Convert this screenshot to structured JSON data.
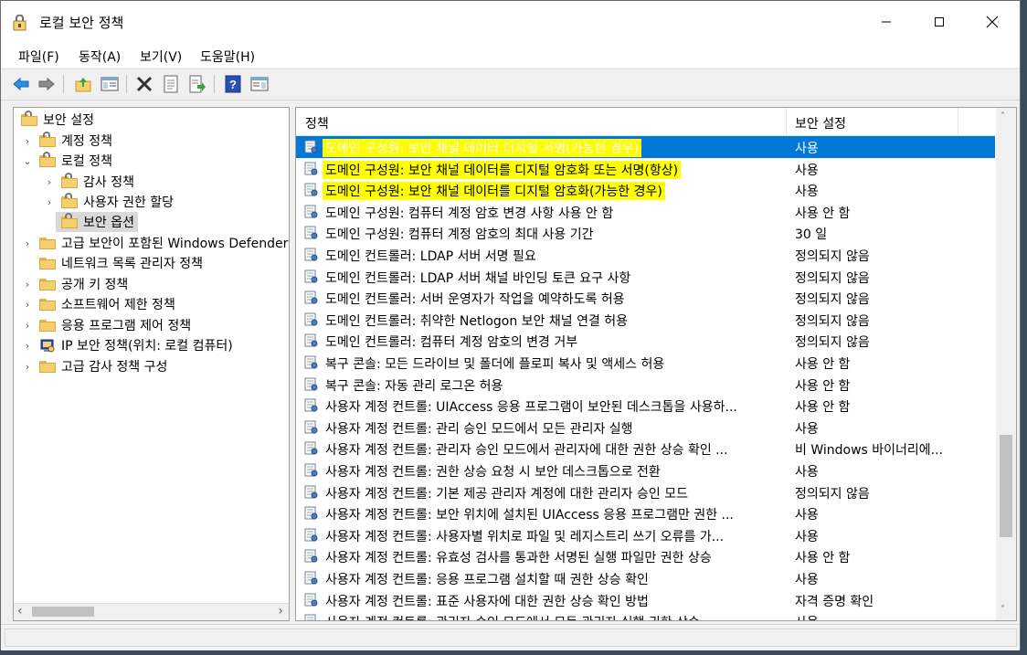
{
  "window": {
    "title": "로컬 보안 정책",
    "caption": {
      "minimize": "─",
      "maximize": "☐",
      "close": "✕"
    }
  },
  "menu": [
    "파일(F)",
    "동작(A)",
    "보기(V)",
    "도움말(H)"
  ],
  "toolbar": {
    "icons": [
      "back-icon",
      "forward-icon",
      "up-folder-icon",
      "show-hide-tree-icon",
      "delete-icon",
      "properties-icon",
      "export-list-icon",
      "help-icon",
      "show-console-icon"
    ]
  },
  "tree": {
    "root": "보안 설정",
    "items": [
      {
        "label": "계정 정책",
        "expander": "›"
      },
      {
        "label": "로컬 정책",
        "expander": "⌄"
      },
      {
        "label": "감사 정책",
        "expander": "›"
      },
      {
        "label": "사용자 권한 할당",
        "expander": "›"
      },
      {
        "label": "보안 옵션",
        "expander": ""
      },
      {
        "label": "고급 보안이 포함된 Windows Defender",
        "expander": "›"
      },
      {
        "label": "네트워크 목록 관리자 정책",
        "expander": ""
      },
      {
        "label": "공개 키 정책",
        "expander": "›"
      },
      {
        "label": "소프트웨어 제한 정책",
        "expander": "›"
      },
      {
        "label": "응용 프로그램 제어 정책",
        "expander": "›"
      },
      {
        "label": "IP 보안 정책(위치: 로컬 컴퓨터)",
        "expander": "›"
      },
      {
        "label": "고급 감사 정책 구성",
        "expander": "›"
      }
    ],
    "scroll": {
      "left": "‹",
      "right": "›"
    }
  },
  "list": {
    "columns": {
      "policy": "정책",
      "setting": "보안 설정",
      "sort_indicator": "˄"
    },
    "rows": [
      {
        "policy": "도메인 구성원: 보안 채널 데이터 디지털 서명(가능한 경우)",
        "setting": "사용"
      },
      {
        "policy": "도메인 구성원: 보안 채널 데이터를 디지털 암호화 또는 서명(항상)",
        "setting": "사용"
      },
      {
        "policy": "도메인 구성원: 보안 채널 데이터를 디지털 암호화(가능한 경우)",
        "setting": "사용"
      },
      {
        "policy": "도메인 구성원: 컴퓨터 계정 암호 변경 사항 사용 안 함",
        "setting": "사용 안 함"
      },
      {
        "policy": "도메인 구성원: 컴퓨터 계정 암호의 최대 사용 기간",
        "setting": "30 일"
      },
      {
        "policy": "도메인 컨트롤러: LDAP 서버 서명 필요",
        "setting": "정의되지 않음"
      },
      {
        "policy": "도메인 컨트롤러: LDAP 서버 채널 바인딩 토큰 요구 사항",
        "setting": "정의되지 않음"
      },
      {
        "policy": "도메인 컨트롤러: 서버 운영자가 작업을 예약하도록 허용",
        "setting": "정의되지 않음"
      },
      {
        "policy": "도메인 컨트롤러: 취약한 Netlogon 보안 채널 연결 허용",
        "setting": "정의되지 않음"
      },
      {
        "policy": "도메인 컨트롤러: 컴퓨터 계정 암호의 변경 거부",
        "setting": "정의되지 않음"
      },
      {
        "policy": "복구 콘솔: 모든 드라이브 및 폴더에 플로피 복사 및 액세스 허용",
        "setting": "사용 안 함"
      },
      {
        "policy": "복구 콘솔: 자동 관리 로그온 허용",
        "setting": "사용 안 함"
      },
      {
        "policy": "사용자 계정 컨트롤: UIAccess 응용 프로그램이 보안된 데스크톱을 사용하...",
        "setting": "사용 안 함"
      },
      {
        "policy": "사용자 계정 컨트롤: 관리 승인 모드에서 모든 관리자 실행",
        "setting": "사용"
      },
      {
        "policy": "사용자 계정 컨트롤: 관리자 승인 모드에서 관리자에 대한 권한 상승 확인 ...",
        "setting": "비 Windows 바이너리에..."
      },
      {
        "policy": "사용자 계정 컨트롤: 권한 상승 요청 시 보안 데스크톱으로 전환",
        "setting": "사용"
      },
      {
        "policy": "사용자 계정 컨트롤: 기본 제공 관리자 계정에 대한 관리자 승인 모드",
        "setting": "정의되지 않음"
      },
      {
        "policy": "사용자 계정 컨트롤: 보안 위치에 설치된 UIAccess 응용 프로그램만 권한 ...",
        "setting": "사용"
      },
      {
        "policy": "사용자 계정 컨트롤: 사용자별 위치로 파일 및 레지스트리 쓰기 오류를 가...",
        "setting": "사용"
      },
      {
        "policy": "사용자 계정 컨트롤: 유효성 검사를 통과한 서명된 실행 파일만 권한 상승",
        "setting": "사용 안 함"
      },
      {
        "policy": "사용자 계정 컨트롤: 응용 프로그램 설치할 때 권한 상승 확인",
        "setting": "사용"
      },
      {
        "policy": "사용자 계정 컨트롤: 표준 사용자에 대한 권한 상승 확인 방법",
        "setting": "자격 증명 확인"
      },
      {
        "policy": "사용자 계정 컨트롤: 관리자 승인 모드에서 모든 관리자 실행 권한 상승",
        "setting": "사용"
      }
    ],
    "selected_index": 0,
    "highlighted_indices": [
      0,
      1,
      2
    ],
    "scroll": {
      "up": "˄",
      "down": "˅"
    }
  },
  "colors": {
    "selection": "#0078d7",
    "highlight": "#ffff00",
    "window_bg": "#f0f0f0"
  }
}
